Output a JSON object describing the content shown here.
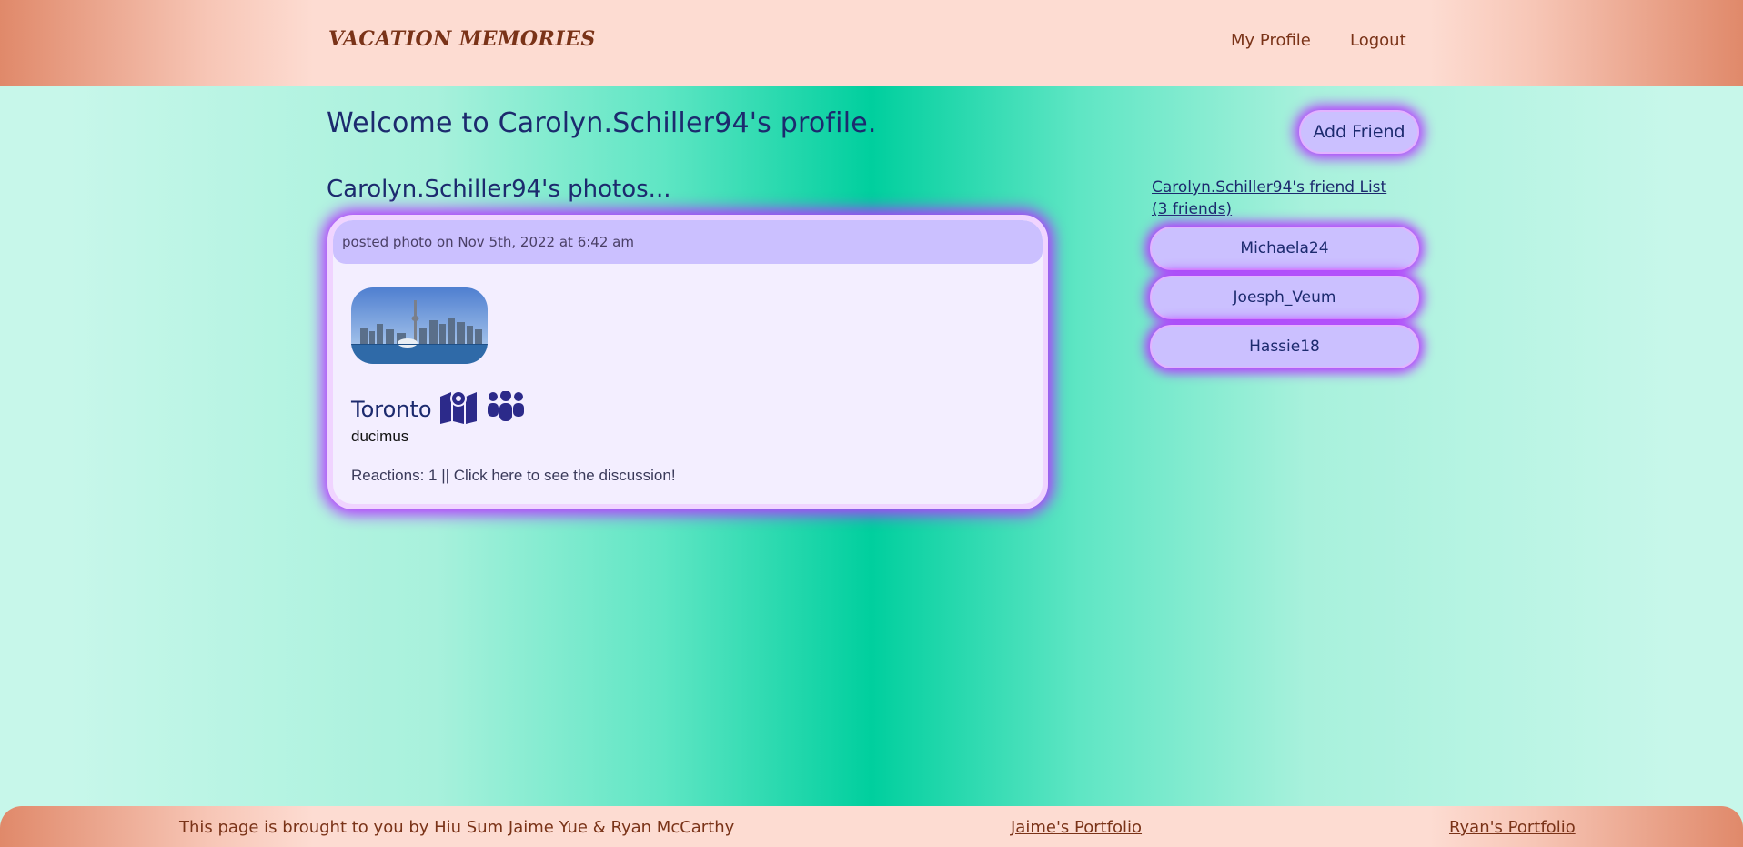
{
  "header": {
    "logo": "VACATION MEMORIES",
    "nav": {
      "profile": "My Profile",
      "logout": "Logout"
    }
  },
  "profile": {
    "welcome": "Welcome to Carolyn.Schiller94's profile.",
    "add_friend": "Add Friend",
    "photos_title": "Carolyn.Schiller94's photos..."
  },
  "post": {
    "header": "posted photo on Nov 5th, 2022 at 6:42 am",
    "place": "Toronto",
    "icons": [
      "map-icon",
      "people-group-icon"
    ],
    "description": "ducimus",
    "reactions": "Reactions: 1 || Click here to see the discussion!"
  },
  "friends": {
    "title": "Carolyn.Schiller94's friend List (3 friends)",
    "items": [
      "Michaela24",
      "Joesph_Veum",
      "Hassie18"
    ]
  },
  "footer": {
    "credit": "This page is brought to you by Hiu Sum Jaime Yue & Ryan McCarthy",
    "jaime_link": "Jaime's Portfolio",
    "ryan_link": "Ryan's Portfolio"
  },
  "colors": {
    "accent": "#b438ff",
    "text": "#1c2a6e",
    "header": "#fddcd2"
  }
}
